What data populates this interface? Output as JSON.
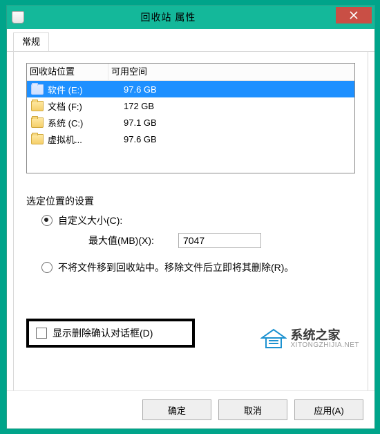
{
  "title": "回收站 属性",
  "tabs": {
    "general": "常规"
  },
  "drivelist": {
    "header": {
      "location": "回收站位置",
      "space": "可用空间"
    },
    "rows": [
      {
        "name": "软件 (E:)",
        "space": "97.6 GB",
        "selected": true
      },
      {
        "name": "文档 (F:)",
        "space": "172 GB",
        "selected": false
      },
      {
        "name": "系统 (C:)",
        "space": "97.1 GB",
        "selected": false
      },
      {
        "name": "虚拟机...",
        "space": "97.6 GB",
        "selected": false
      }
    ]
  },
  "settings": {
    "group_label": "选定位置的设置",
    "custom_size_label": "自定义大小(C):",
    "max_label": "最大值(MB)(X):",
    "max_value": "7047",
    "dont_move_label": "不将文件移到回收站中。移除文件后立即将其删除(R)。",
    "show_confirm_label": "显示删除确认对话框(D)"
  },
  "buttons": {
    "ok": "确定",
    "cancel": "取消",
    "apply": "应用(A)"
  },
  "watermark": {
    "title": "系统之家",
    "sub": "XITONGZHIJIA.NET"
  },
  "colors": {
    "accent": "#14b89a",
    "selection": "#1e90ff",
    "close": "#c94f45"
  }
}
